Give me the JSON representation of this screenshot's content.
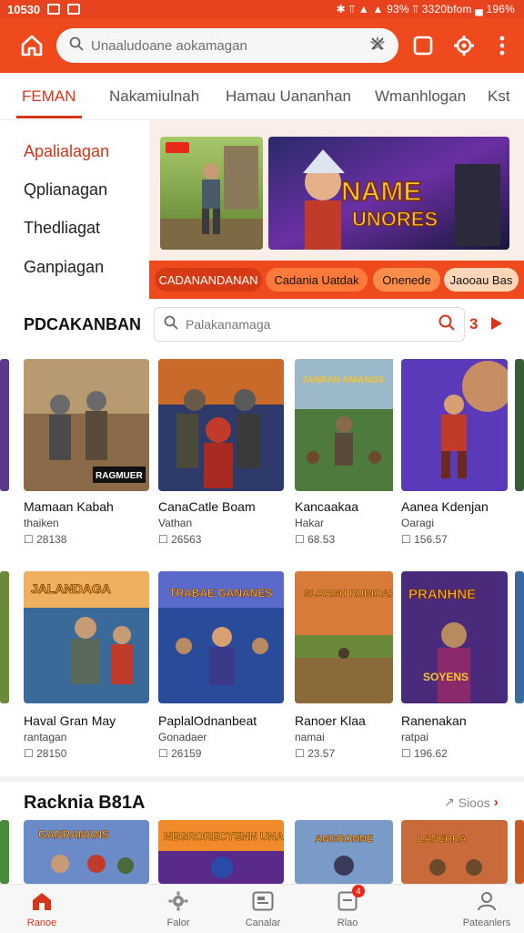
{
  "status_bar": {
    "time": "10530",
    "right_text": "✱ ⫪ ▲ ▲ 93% ⫪ 3320bfom ▄ 196%"
  },
  "app_bar": {
    "search_placeholder": "Unaaludoane aokamagan"
  },
  "tabs": [
    {
      "label": "FEMAN",
      "active": true
    },
    {
      "label": "Nakamiulnah"
    },
    {
      "label": "Hamau Uananhan"
    },
    {
      "label": "Wmanhlogan"
    },
    {
      "label": "Kst"
    }
  ],
  "categories": [
    {
      "label": "Apalialagan",
      "active": true
    },
    {
      "label": "Qplianagan"
    },
    {
      "label": "Thedliagat"
    },
    {
      "label": "Ganpiagan"
    }
  ],
  "banner": {
    "main_title_line1": "NAME",
    "main_title_line2": "UNORES",
    "pills": [
      "CADANANDANAN",
      "Cadania Uatdak",
      "Onenede",
      "Jaooau Bas"
    ]
  },
  "search_section": {
    "title": "PDCAKANBAN",
    "placeholder": "Palakanamaga",
    "count": "3"
  },
  "games_row1": [
    {
      "name": "Mamaan Kabah",
      "sub": "thaiken",
      "meta": "☐ 28138",
      "banner": "RAGMUER"
    },
    {
      "name": "CanaCatle Boam",
      "sub": "Vathan",
      "meta": "☐ 26563",
      "banner": ""
    },
    {
      "name": "Kancaakaa",
      "sub": "Hakar",
      "meta": "☐ 68.53",
      "banner": "JANRAN ANIANGS"
    },
    {
      "name": "Aanea Kdenjan",
      "sub": "Oaragi",
      "meta": "☐ 156.57",
      "banner": ""
    }
  ],
  "games_row2": [
    {
      "name": "Haval Gran May",
      "sub": "rantagan",
      "meta": "☐ 28150",
      "banner": "JALANDAGA"
    },
    {
      "name": "PaplalOdnanbeat",
      "sub": "Gonadaer",
      "meta": "☐ 26159",
      "banner": "TRABAE GANANES"
    },
    {
      "name": "Ranoer Klaa",
      "sub": "namai",
      "meta": "☐ 23.57",
      "banner": "SLORGH RUBIOAR"
    },
    {
      "name": "Ranenakan",
      "sub": "ratpai",
      "meta": "☐ 196.62",
      "banner": "PRANHNE",
      "banner2": "SOYENS"
    }
  ],
  "section2": {
    "title": "Racknia B81A",
    "see_all": "Sioos",
    "banners": [
      "GANRANANS",
      "NEGRORECYENN UNANKAN",
      "ANGRONNE",
      "LANERRA"
    ]
  },
  "bottom_nav": [
    {
      "label": "Ranoe",
      "active": true
    },
    {
      "label": "Falor"
    },
    {
      "label": "Canalar"
    },
    {
      "label": "Rlao",
      "badge": "4"
    },
    {
      "label": "Pateanlers"
    }
  ],
  "colors": {
    "brand": "#ee4a1e",
    "accent": "#d8341a"
  }
}
